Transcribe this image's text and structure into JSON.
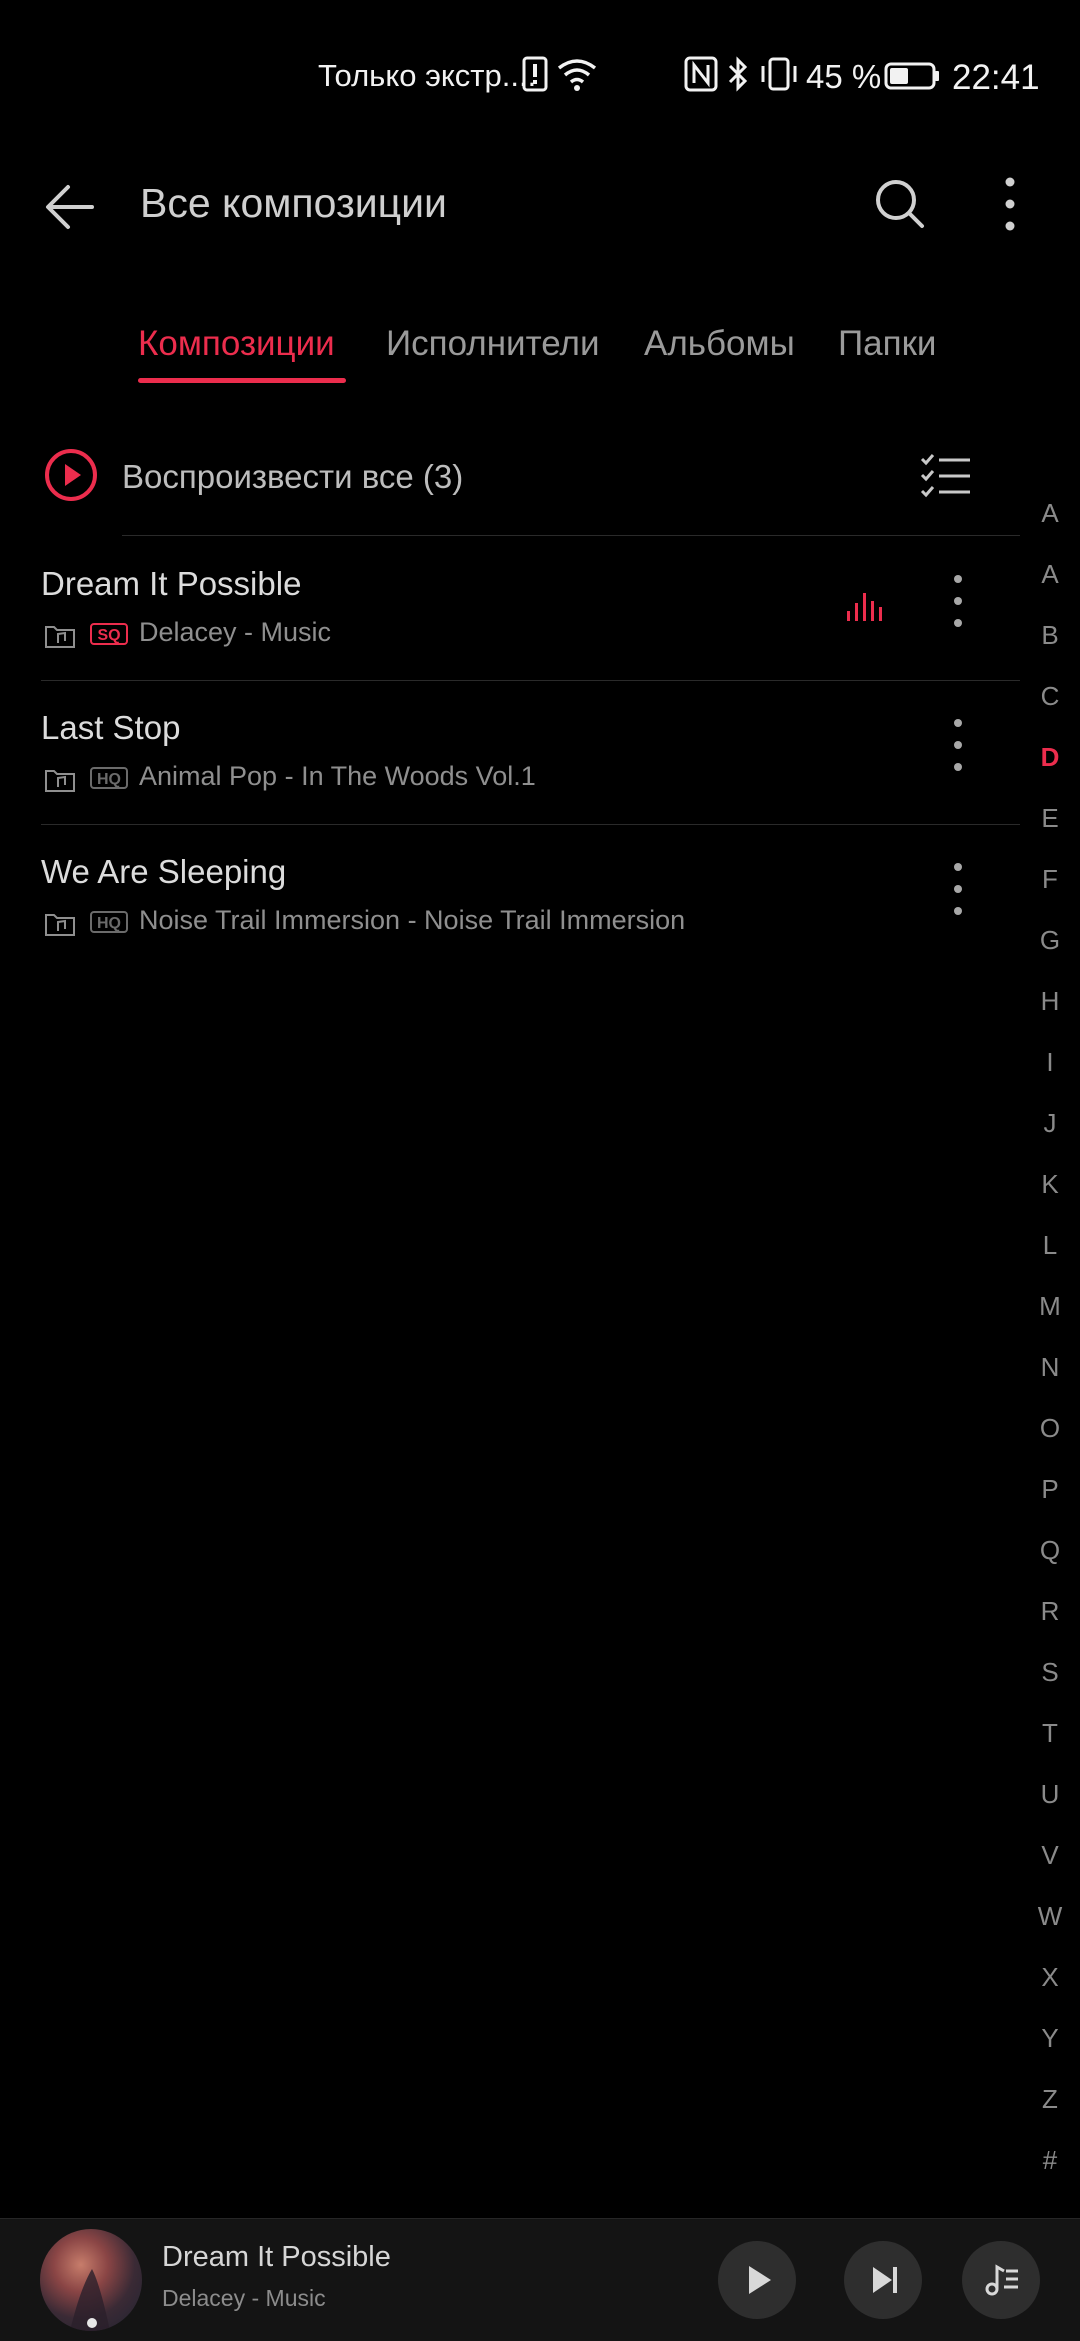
{
  "status_bar": {
    "carrier": "Только экстр....",
    "battery_percent": "45 %",
    "time": "22:41",
    "icons": [
      "sim-alert-icon",
      "wifi-icon",
      "nfc-icon",
      "bluetooth-icon",
      "vibrate-icon",
      "battery-icon"
    ],
    "battery_level": 0.45
  },
  "header": {
    "title": "Все композиции",
    "back_icon": "arrow-left-icon",
    "search_icon": "search-icon",
    "more_icon": "more-vertical-icon"
  },
  "tabs": [
    {
      "label": "Композиции",
      "active": true
    },
    {
      "label": "Исполнители",
      "active": false
    },
    {
      "label": "Альбомы",
      "active": false
    },
    {
      "label": "Папки",
      "active": false
    }
  ],
  "play_all": {
    "label": "Воспроизвести все (3)",
    "icon": "play-circle-icon",
    "multiselect_icon": "checklist-icon"
  },
  "songs": [
    {
      "title": "Dream It Possible",
      "quality": "SQ",
      "subtitle": "Delacey - Music",
      "playing": true
    },
    {
      "title": "Last Stop",
      "quality": "HQ",
      "subtitle": "Animal Pop - In The Woods Vol.1",
      "playing": false
    },
    {
      "title": "We Are Sleeping",
      "quality": "HQ",
      "subtitle": "Noise Trail Immersion - Noise Trail Immersion",
      "playing": false
    }
  ],
  "alphabet": {
    "letters": [
      "A",
      "A",
      "B",
      "C",
      "D",
      "E",
      "F",
      "G",
      "H",
      "I",
      "J",
      "K",
      "L",
      "M",
      "N",
      "O",
      "P",
      "Q",
      "R",
      "S",
      "T",
      "U",
      "V",
      "W",
      "X",
      "Y",
      "Z",
      "#"
    ],
    "active": "D"
  },
  "mini_player": {
    "title": "Dream It Possible",
    "subtitle": "Delacey - Music",
    "buttons": [
      "play-icon",
      "skip-next-icon",
      "playlist-icon"
    ]
  },
  "colors": {
    "accent": "#ec2d4d",
    "background": "#000000",
    "text_primary": "#dcdcdc",
    "text_secondary": "#8f8f8f"
  }
}
